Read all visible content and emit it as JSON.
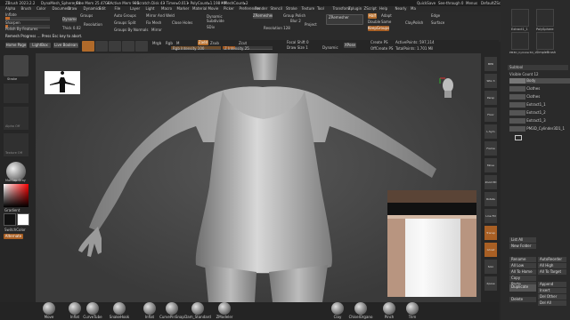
{
  "title_bar": {
    "app": "ZBrush 2023.2.2",
    "document": "DynaMesh_Sphere_64",
    "free_mem": "• Free Mem 25.47GB",
    "active_mem": "• Active Mem 930",
    "scratch": "• Scratch Disk 43",
    "timer": "• Timer▸0.011",
    "polycount": "• PolyCount▸1.198 MP",
    "meshcount": "• MeshCount▸2",
    "quicksave": "QuickSave",
    "seethrough": "See-through 0",
    "menus": "Menus",
    "default_script": "DefaultZScript"
  },
  "menu_bar": [
    "Alpha",
    "Brush",
    "Color",
    "Document",
    "Draw",
    "Dynamics",
    "Edit",
    "File",
    "Layer",
    "Light",
    "Macro",
    "Marker",
    "Material",
    "Movie",
    "Picker",
    "Preferences",
    "Render",
    "Stencil",
    "Stroke",
    "Texture",
    "Tool",
    "Transform",
    "Zplugin",
    "ZScript",
    "Help",
    "Nearly",
    "Ma"
  ],
  "top_controls": {
    "inflate": "Inflate",
    "sharpen": "Sharpen",
    "polish_by_features": "Polish By Features",
    "remesh_progress": "Remesh Progress … Press Esc key to abort.",
    "dynamesh": "Dynamesh",
    "groups": "Groups",
    "thick": "Thick 0.02",
    "resolution_small": "Resolution",
    "auto_groups": "Auto Groups",
    "mirror_weld": "Mirror And Weld",
    "groups_split": "Groups Split",
    "fix_mesh": "Fix Mesh",
    "close_holes": "Close Holes",
    "groups_by_normals": "Groups By Normals",
    "mirror": "Mirror",
    "dynamic": "Dynamic",
    "subdivide": "Subdivide",
    "zremesher_legacy": "ZRemesher",
    "sdiv": "SDiv",
    "resolution": "Resolution 128",
    "group_polish": "Group Polish",
    "blur": "Blur 2",
    "project": "Project",
    "zremesher": "ZRemesher",
    "half": "Half",
    "adapt": "Adapt",
    "double": "Double",
    "same": "Same",
    "keep_groups": "KeepGroups",
    "clay_polish": "ClayPolish",
    "edge": "Edge",
    "surface": "Surface",
    "home_page": "Home Page",
    "lightbox": "LightBox",
    "live_boolean": "Live Boolean",
    "edit": "Edit",
    "draw": "Draw",
    "move": "Move",
    "scale": "Scale",
    "rotate": "Rotate",
    "mrgb": "Mrgb",
    "rgb": "Rgb",
    "m": "M",
    "zadd": "Zadd",
    "zsub": "Zsub",
    "zcut": "Zcut",
    "rgb_intensity": "Rgb Intensity 100",
    "z_intensity": "Z Intensity 25",
    "focal_shift": "Focal Shift 0",
    "draw_size": "Draw Size 1",
    "dynamic_label": "Dynamic",
    "active_points": "ActivePoints: 597,114",
    "total_points": "TotalPoints: 1.701 Mil",
    "xpose": "XPose",
    "create_ps": "Create PS",
    "off_create_ps": "OffCreate PS"
  },
  "left_shelf": {
    "stroke_label": "Stroke",
    "alpha_label": "Alpha Off",
    "texture_label": "Texture Off",
    "material_label": "MatCap Gray",
    "gradient": "Gradient",
    "switch_color": "SwitchColor",
    "alternate": "Alternate"
  },
  "right_toolbar": [
    "BPR",
    "SPix 3",
    "Persp",
    "Floor",
    "L.Sym",
    "Frame",
    "Move",
    "Zoom3D",
    "Rotate",
    "Line Fill",
    "Transp",
    "Ghost",
    "Solo",
    "Xpose"
  ],
  "subtool": {
    "header": "Subtool",
    "visible_count": "Visible Count 12",
    "items": [
      {
        "name": "Body"
      },
      {
        "name": "Clothes"
      },
      {
        "name": "Extract1_1"
      },
      {
        "name": "Extract1_2"
      },
      {
        "name": "Extract1_3"
      },
      {
        "name": "PM3D_Cylinder3D1_1"
      }
    ],
    "tool_thumbs": [
      "Extract1_1",
      "PolySphere",
      "PM3D_Cylinder3D_1",
      "SimpleBrush"
    ],
    "list_all": "List All",
    "new_folder": "New Folder",
    "rename": "Rename",
    "auto_reorder": "AutoReorder",
    "all_low": "All Low",
    "all_high": "All High",
    "all_to_home": "All To Home",
    "all_to_target": "All To Target",
    "copy": "Copy",
    "paste": "Paste",
    "append": "Append",
    "duplicate": "Duplicate",
    "insert": "Insert",
    "del_other": "Del Other",
    "delete": "Delete",
    "del_all": "Del All"
  },
  "bottom_brushes": [
    "Move",
    "Inflat",
    "CurveTube",
    "SnakeHook",
    "Inflat",
    "CurvePinSnap",
    "Dam_Standard",
    "ZModeler"
  ],
  "bottom_right_brushes": [
    "Clay",
    "ChiselOrgano",
    "Pinch",
    "Trim"
  ],
  "colors": {
    "accent": "#e8823a",
    "background": "#262626",
    "viewport": "#4a4a4a"
  }
}
